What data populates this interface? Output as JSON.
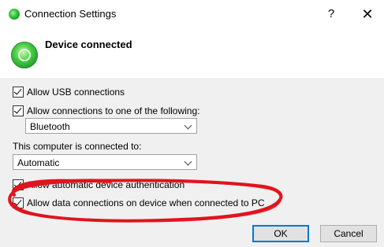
{
  "window": {
    "title": "Connection Settings",
    "help_label": "?",
    "close_label": "✕"
  },
  "header": {
    "title": "Device connected",
    "icon": "device-connected-icon"
  },
  "options": {
    "allow_usb_label": "Allow USB connections",
    "allow_usb_checked": true,
    "allow_one_of_label": "Allow connections to one of the following:",
    "allow_one_of_checked": true,
    "connection_type_value": "Bluetooth",
    "connected_to_label": "This computer is connected to:",
    "connected_to_value": "Automatic",
    "allow_auto_auth_label": "Allow automatic device authentication",
    "allow_auto_auth_checked": true,
    "allow_data_label": "Allow data connections on device when connected to PC",
    "allow_data_checked": true
  },
  "buttons": {
    "ok_label": "OK",
    "cancel_label": "Cancel"
  },
  "colors": {
    "annotation": "#e0141e",
    "primary_border": "#0078d7"
  }
}
